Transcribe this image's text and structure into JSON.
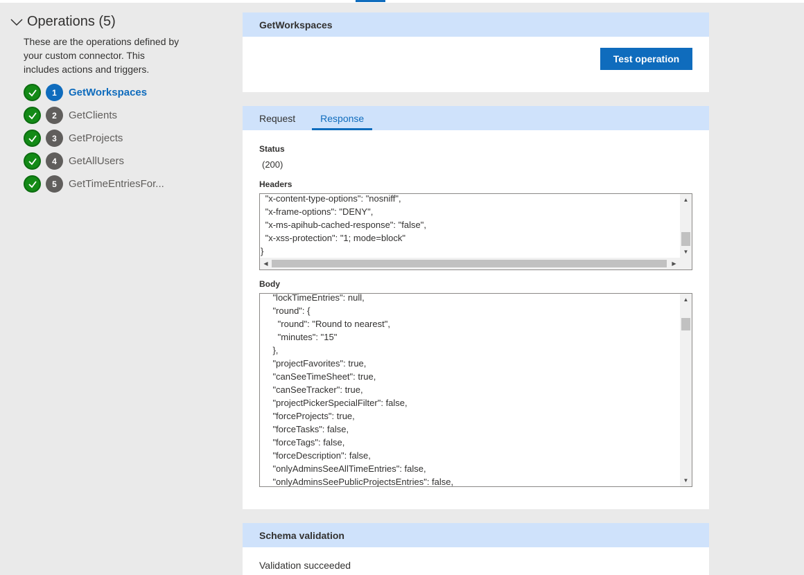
{
  "operations": {
    "title": "Operations (5)",
    "description": "These are the operations defined by your custom connector. This includes actions and triggers.",
    "items": [
      {
        "number": "1",
        "label": "GetWorkspaces",
        "active": true
      },
      {
        "number": "2",
        "label": "GetClients",
        "active": false
      },
      {
        "number": "3",
        "label": "GetProjects",
        "active": false
      },
      {
        "number": "4",
        "label": "GetAllUsers",
        "active": false
      },
      {
        "number": "5",
        "label": "GetTimeEntriesFor...",
        "active": false
      }
    ]
  },
  "operation_card": {
    "title": "GetWorkspaces",
    "test_button": "Test operation"
  },
  "response_card": {
    "tabs": [
      "Request",
      "Response"
    ],
    "active_tab": "Response",
    "status_label": "Status",
    "status_value": "(200)",
    "headers_label": "Headers",
    "headers_lines": [
      " \"x-content-type-options\": \"nosniff\",",
      " \"x-frame-options\": \"DENY\",",
      " \"x-ms-apihub-cached-response\": \"false\",",
      " \"x-xss-protection\": \"1; mode=block\"",
      "}"
    ],
    "body_label": "Body",
    "body_lines": [
      "    \"lockTimeEntries\": null,",
      "    \"round\": {",
      "      \"round\": \"Round to nearest\",",
      "      \"minutes\": \"15\"",
      "    },",
      "    \"projectFavorites\": true,",
      "    \"canSeeTimeSheet\": true,",
      "    \"canSeeTracker\": true,",
      "    \"projectPickerSpecialFilter\": false,",
      "    \"forceProjects\": true,",
      "    \"forceTasks\": false,",
      "    \"forceTags\": false,",
      "    \"forceDescription\": false,",
      "    \"onlyAdminsSeeAllTimeEntries\": false,",
      "    \"onlyAdminsSeePublicProjectsEntries\": false,"
    ]
  },
  "schema_card": {
    "title": "Schema validation",
    "result": "Validation succeeded"
  },
  "colors": {
    "accent": "#0f6cbd",
    "success": "#138a16",
    "header_band": "#cfe2fb"
  }
}
